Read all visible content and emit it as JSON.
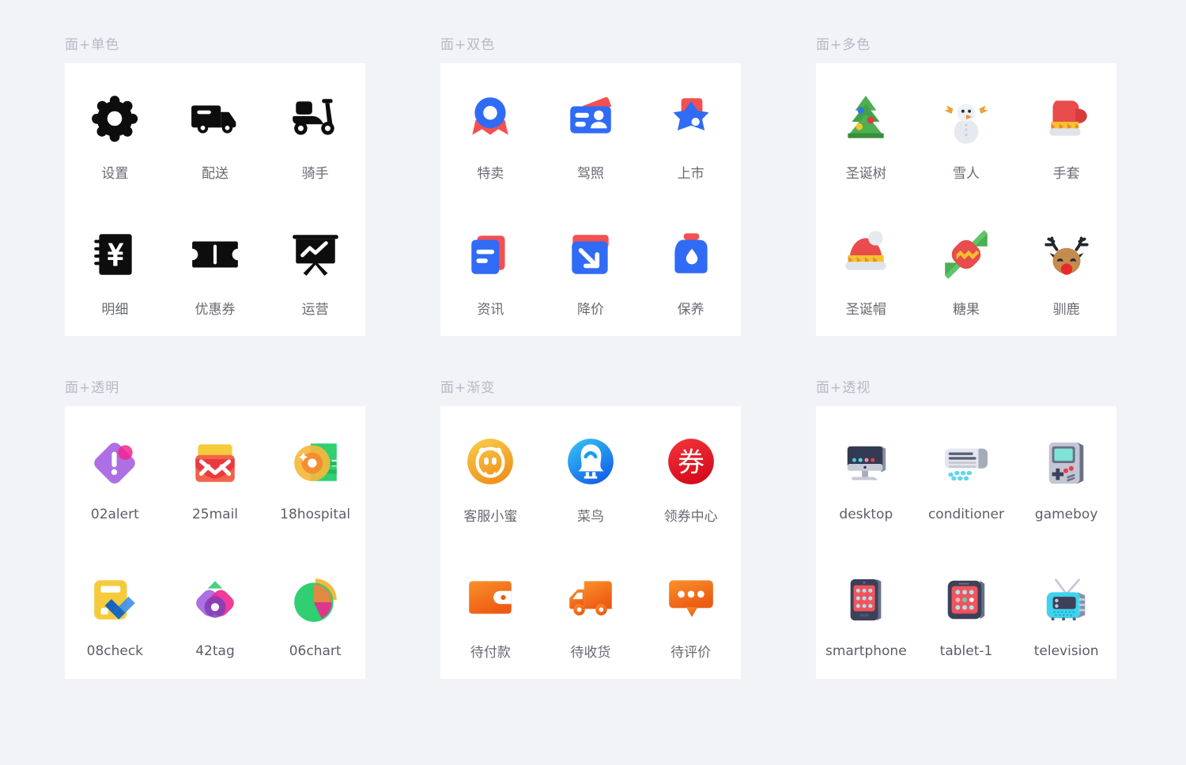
{
  "sections": [
    {
      "title": "面+单色",
      "style": "mono",
      "items": [
        {
          "label": "设置",
          "icon": "gear-icon"
        },
        {
          "label": "配送",
          "icon": "truck-icon"
        },
        {
          "label": "骑手",
          "icon": "scooter-icon"
        },
        {
          "label": "明细",
          "icon": "ledger-yuan-icon"
        },
        {
          "label": "优惠券",
          "icon": "ticket-icon"
        },
        {
          "label": "运营",
          "icon": "presentation-chart-icon"
        }
      ]
    },
    {
      "title": "面+双色",
      "style": "duotone",
      "items": [
        {
          "label": "特卖",
          "icon": "medal-ribbon-icon"
        },
        {
          "label": "驾照",
          "icon": "id-card-icon"
        },
        {
          "label": "上市",
          "icon": "star-badge-icon"
        },
        {
          "label": "资讯",
          "icon": "news-document-icon"
        },
        {
          "label": "降价",
          "icon": "arrow-down-right-icon"
        },
        {
          "label": "保养",
          "icon": "oil-bottle-icon"
        }
      ]
    },
    {
      "title": "面+多色",
      "style": "multicolor",
      "items": [
        {
          "label": "圣诞树",
          "icon": "christmas-tree-icon"
        },
        {
          "label": "雪人",
          "icon": "snowman-icon"
        },
        {
          "label": "手套",
          "icon": "mitten-icon"
        },
        {
          "label": "圣诞帽",
          "icon": "santa-hat-icon"
        },
        {
          "label": "糖果",
          "icon": "candy-icon"
        },
        {
          "label": "驯鹿",
          "icon": "reindeer-icon"
        }
      ]
    },
    {
      "title": "面+透明",
      "style": "transparent",
      "items": [
        {
          "label": "02alert",
          "icon": "alert-diamond-icon"
        },
        {
          "label": "25mail",
          "icon": "mail-envelope-icon"
        },
        {
          "label": "18hospital",
          "icon": "coin-money-icon"
        },
        {
          "label": "08check",
          "icon": "checklist-icon"
        },
        {
          "label": "42tag",
          "icon": "tags-icon"
        },
        {
          "label": "06chart",
          "icon": "pie-chart-icon"
        }
      ]
    },
    {
      "title": "面+渐变",
      "style": "gradient",
      "items": [
        {
          "label": "客服小蜜",
          "icon": "service-bee-icon"
        },
        {
          "label": "菜鸟",
          "icon": "cainiao-bird-icon"
        },
        {
          "label": "领券中心",
          "icon": "coupon-circle-icon"
        },
        {
          "label": "待付款",
          "icon": "wallet-icon"
        },
        {
          "label": "待收货",
          "icon": "delivery-truck-icon"
        },
        {
          "label": "待评价",
          "icon": "comment-dots-icon"
        }
      ]
    },
    {
      "title": "面+透视",
      "style": "perspective",
      "items": [
        {
          "label": "desktop",
          "icon": "desktop-monitor-icon"
        },
        {
          "label": "conditioner",
          "icon": "air-conditioner-icon"
        },
        {
          "label": "gameboy",
          "icon": "gameboy-icon"
        },
        {
          "label": "smartphone",
          "icon": "smartphone-icon"
        },
        {
          "label": "tablet-1",
          "icon": "tablet-icon"
        },
        {
          "label": "television",
          "icon": "television-icon"
        }
      ]
    }
  ],
  "colors": {
    "background": "#f2f3f7",
    "card": "#ffffff",
    "section_title": "#b7bac4",
    "caption": "#666a70",
    "mono": "#0d0d0d",
    "duotone_blue": "#2f6bf5",
    "duotone_red": "#f4504f",
    "gradient_orange": "#f97b1f",
    "gradient_red": "#e8202a",
    "gradient_blue": "#1a9df0"
  }
}
